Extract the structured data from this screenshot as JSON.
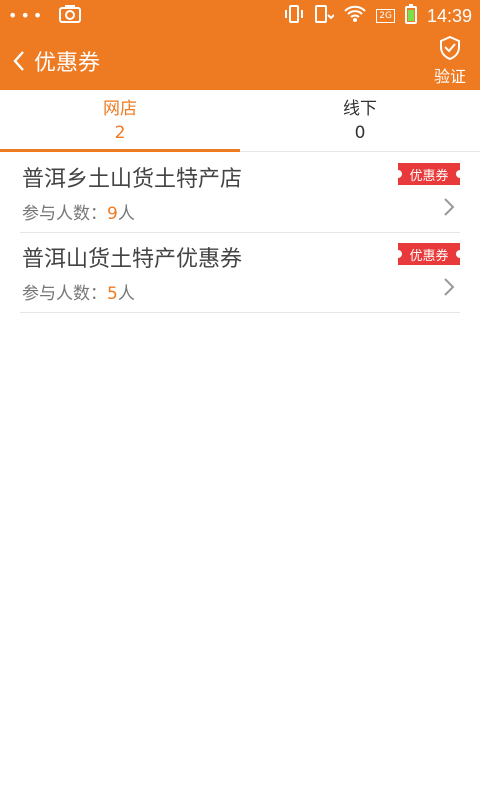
{
  "status_bar": {
    "time": "14:39",
    "network": "2G"
  },
  "header": {
    "title": "优惠券",
    "verify_label": "验证"
  },
  "tabs": [
    {
      "label": "网店",
      "count": "2",
      "active": true
    },
    {
      "label": "线下",
      "count": "0",
      "active": false
    }
  ],
  "list": [
    {
      "title": "普洱乡土山货土特产店",
      "participants_label": "参与人数：",
      "participants_count": "9",
      "unit": "人",
      "badge": "优惠券"
    },
    {
      "title": "普洱山货土特产优惠券",
      "participants_label": "参与人数：",
      "participants_count": "5",
      "unit": "人",
      "badge": "优惠券"
    }
  ],
  "colors": {
    "accent": "#ee7a22",
    "badge": "#e83a3a",
    "divider": "#e6e6e6"
  }
}
